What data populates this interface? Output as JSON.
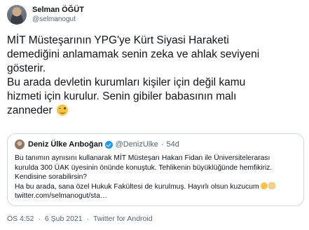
{
  "author": {
    "name": "Selman ÖĞÜT",
    "handle": "@selmanogut"
  },
  "tweet": {
    "lines": [
      "MİT Müsteşarının YPG'ye Kürt Siyasi Haraketi",
      "demediğini anlamamak senin zeka ve ahlak seviyeni",
      "gösterir.",
      "Bu arada devletin kurumları kişiler için değil kamu",
      "hizmeti için kurulur. Senin gibiler babasının malı",
      "zanneder"
    ],
    "trailing_emoji": "winking-face-emoji"
  },
  "quote": {
    "name": "Deniz Ülke Arıboğan",
    "handle": "@DenizUlke",
    "separator": "·",
    "time": "54d",
    "lines": [
      "Bu tanımın aynısını kullanarak MİT Müsteşarı Hakan Fidan ile Üniversitelerarası",
      "kurulda 300 ÜAK üyesinin önünde konuştuk. Tehlikenin büyüklüğünde hemfikiriz.",
      "Kendisine sorabilirsin?",
      "Ha bu arada, sana özel Hukuk Fakültesi de kurulmuş. Hayırlı olsun kuzucum",
      "twitter.com/selmanogut/sta…"
    ],
    "trailing_emojis": [
      "grinning-sweat-emoji",
      "waving-hand-emoji"
    ]
  },
  "meta": {
    "time": "ÖS 4:52",
    "dot": "·",
    "date": "6 Şub 2021",
    "dot2": "·",
    "source": "Twitter for Android"
  },
  "colors": {
    "text": "#0f1419",
    "secondary": "#536471",
    "border": "#cfd9de",
    "verified": "#1d9bf0"
  }
}
